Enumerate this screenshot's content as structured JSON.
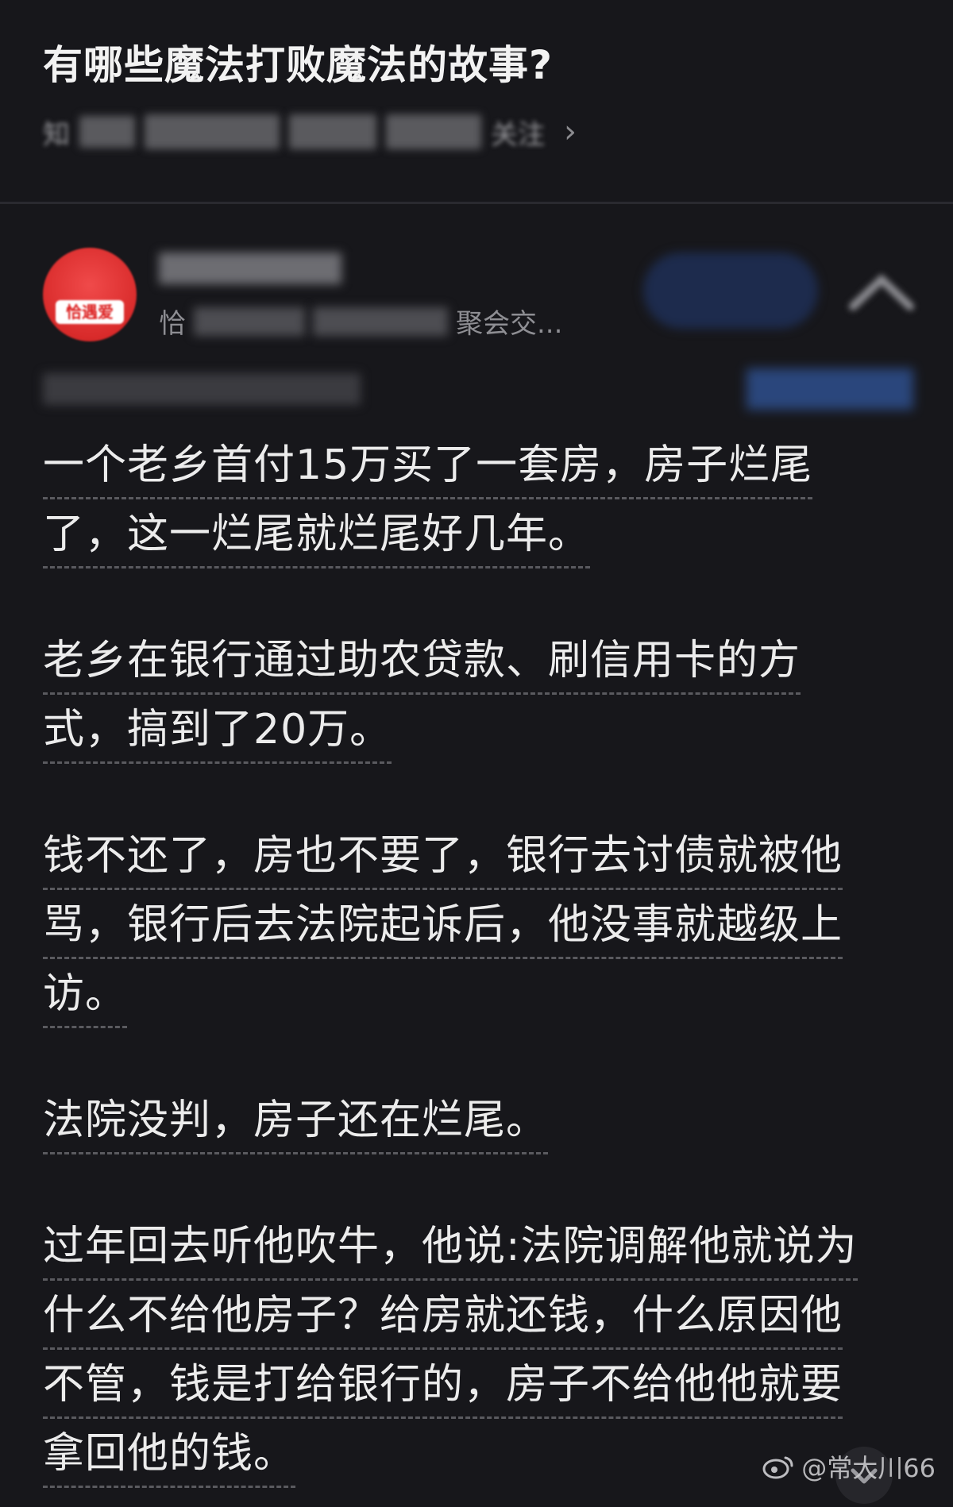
{
  "question": {
    "title": "有哪些魔法打败魔法的故事?",
    "meta_visible": "知",
    "meta_tail": "关注"
  },
  "author": {
    "avatar_text": "恰遇爱",
    "bio_prefix": "恰",
    "bio_suffix": "聚会交..."
  },
  "answer": {
    "paragraphs": [
      [
        "一个老乡首付15万买了一套房，房子烂尾",
        "了，这一烂尾就烂尾好几年。"
      ],
      [
        "老乡在银行通过助农贷款、刷信用卡的方",
        "式，搞到了20万。"
      ],
      [
        "钱不还了，房也不要了，银行去讨债就被他",
        "骂，银行后去法院起诉后，他没事就越级上",
        "访。"
      ],
      [
        "法院没判，房子还在烂尾。"
      ],
      [
        "过年回去听他吹牛，他说:法院调解他就说为",
        "什么不给他房子？给房就还钱，什么原因他",
        "不管，钱是打给银行的，房子不给他他就要",
        "拿回他的钱。"
      ]
    ]
  },
  "watermark": {
    "text": "@常大川66"
  },
  "colors": {
    "background": "#17171b",
    "text": "#ececec",
    "avatar_red": "#d92b2b",
    "follow_blue": "#1d2b4d"
  }
}
